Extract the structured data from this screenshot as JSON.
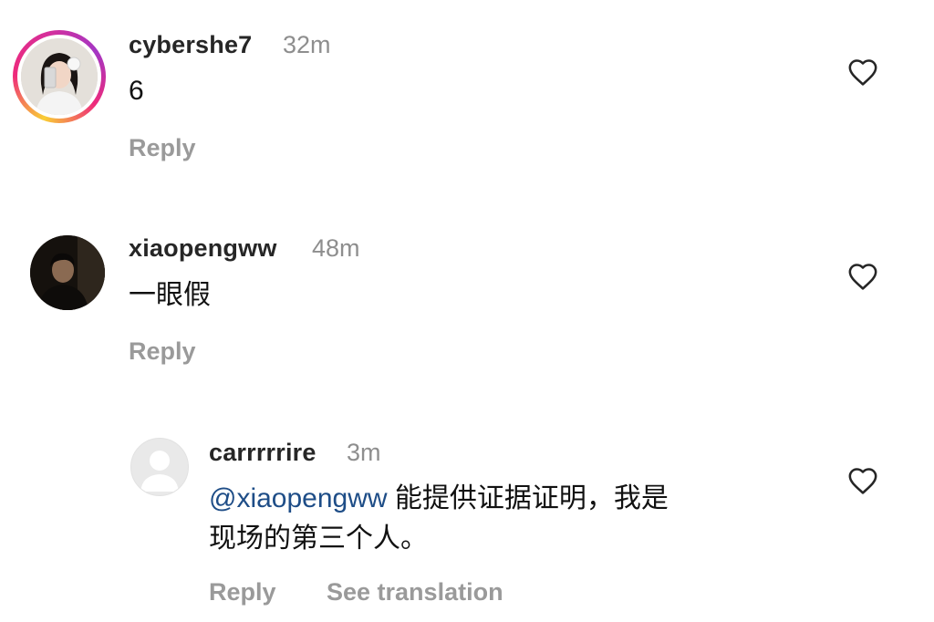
{
  "comments": [
    {
      "username": "cybershe7",
      "time": "32m",
      "text": "6",
      "reply_label": "Reply",
      "avatar_icon": "profile-photo-avatar",
      "has_story_ring": true
    },
    {
      "username": "xiaopengww",
      "time": "48m",
      "text": "一眼假",
      "reply_label": "Reply",
      "avatar_icon": "profile-photo-avatar"
    },
    {
      "username": "carrrrrire",
      "time": "3m",
      "mention": "@xiaopengww",
      "text_line1": " 能提供证据证明，我是",
      "text_line2": "现场的第三个人。",
      "reply_label": "Reply",
      "translation_label": "See translation",
      "avatar_icon": "default-user-avatar"
    }
  ],
  "icons": {
    "like": "heart-outline-icon"
  },
  "colors": {
    "story_ring": [
      "#f9ce34",
      "#ee2a7b",
      "#a436c4"
    ],
    "mention": "#1e4d87",
    "muted": "#8e8e8e"
  }
}
